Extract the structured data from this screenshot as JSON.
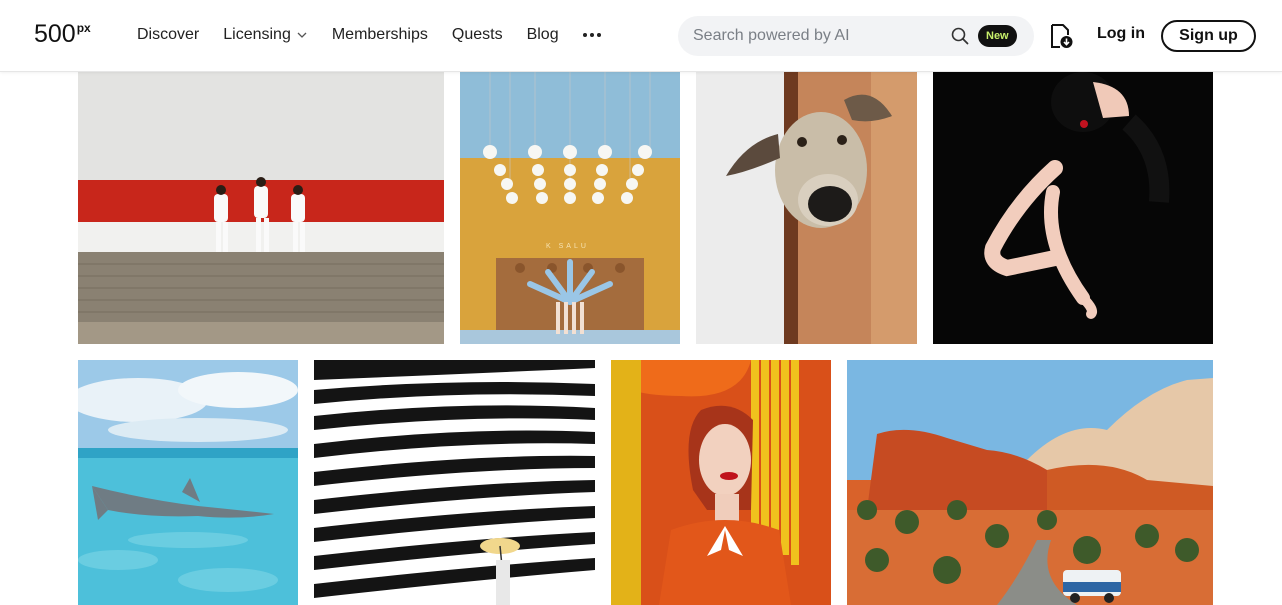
{
  "header": {
    "logo": "500",
    "logo_sup": "px",
    "nav": [
      {
        "label": "Discover"
      },
      {
        "label": "Licensing",
        "has_dropdown": true
      },
      {
        "label": "Memberships"
      },
      {
        "label": "Quests"
      },
      {
        "label": "Blog"
      }
    ],
    "more_icon": "more-dots-icon",
    "search": {
      "placeholder": "Search powered by AI",
      "value": "",
      "icon": "search-icon",
      "badge": "New"
    },
    "download_icon": "download-document-icon",
    "login_label": "Log in",
    "signup_label": "Sign up"
  },
  "gallery": {
    "rows": [
      {
        "photos": [
          {
            "name": "photo-men-walking-red-wall",
            "label": "K SALU"
          },
          {
            "name": "photo-dancers-orange-wall"
          },
          {
            "name": "photo-dog-peeking-door"
          },
          {
            "name": "photo-woman-black-background"
          }
        ]
      },
      {
        "photos": [
          {
            "name": "photo-shark-underwater"
          },
          {
            "name": "photo-black-white-stripes"
          },
          {
            "name": "photo-woman-red-hair-yellow-fringe"
          },
          {
            "name": "photo-red-rock-canyon-car"
          }
        ]
      }
    ]
  },
  "colors": {
    "accent_badge_text": "#c9f06b",
    "search_bg": "#f2f3f5"
  }
}
